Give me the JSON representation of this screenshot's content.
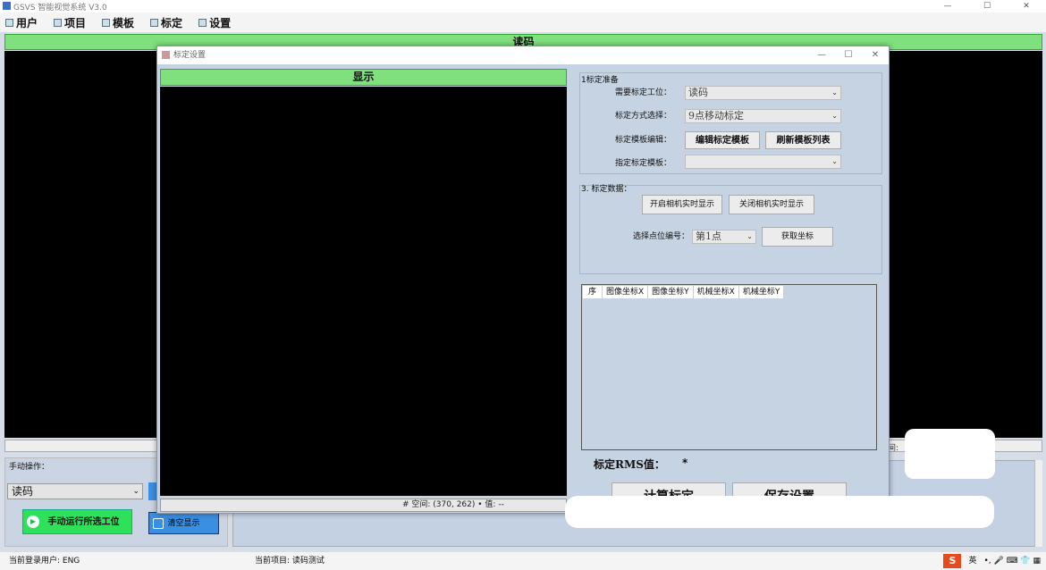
{
  "app": {
    "title": "GSVS  智能视觉系统  V3.0",
    "win_ctrls": [
      "—",
      "☐",
      "✕"
    ]
  },
  "menu": [
    {
      "label": "用户",
      "icon": "user-icon"
    },
    {
      "label": "项目",
      "icon": "project-icon"
    },
    {
      "label": "模板",
      "icon": "template-icon"
    },
    {
      "label": "标定",
      "icon": "calibration-icon"
    },
    {
      "label": "设置",
      "icon": "settings-icon"
    }
  ],
  "main": {
    "header": "读码",
    "readout_stub": "间:"
  },
  "manual": {
    "title": "手动操作：",
    "station": "读码",
    "run_label": "手动运行所选工位",
    "clear_label": "清空显示"
  },
  "status": {
    "user": "当前登录用户:  ENG",
    "project": "当前项目:  读码测试",
    "ime_logo": "S",
    "ime_lang": "英",
    "tray_glyphs": "•, 🎤 ⌨ 👕 ▦"
  },
  "dialog": {
    "title": "标定设置",
    "ctrls": [
      "—",
      "☐",
      "✕"
    ],
    "display_header": "显示",
    "display_status": "# 空间:  (370, 262)  • 值:  --",
    "group1": {
      "title": "1标定准备",
      "station_label": "需要标定工位：",
      "station_value": "读码",
      "method_label": "标定方式选择：",
      "method_value": "9点移动标定",
      "template_label": "标定模板编辑：",
      "edit_btn": "编辑标定模板",
      "refresh_btn": "刷新模板列表",
      "assign_label": "指定标定模板：",
      "assign_value": ""
    },
    "group2": {
      "title": "3. 标定数据：",
      "open_live": "开启相机实时显示",
      "close_live": "关闭相机实时显示",
      "point_label": "选择点位编号：",
      "point_value": "第1点",
      "get_coord": "获取坐标"
    },
    "grid_columns": [
      "图像坐标X",
      "图像坐标Y",
      "机械坐标X",
      "机械坐标Y"
    ],
    "grid_corner": "序",
    "rms_label": "标定RMS值：",
    "rms_value": "*",
    "calc_btn": "计算标定",
    "save_btn": "保存设置"
  }
}
